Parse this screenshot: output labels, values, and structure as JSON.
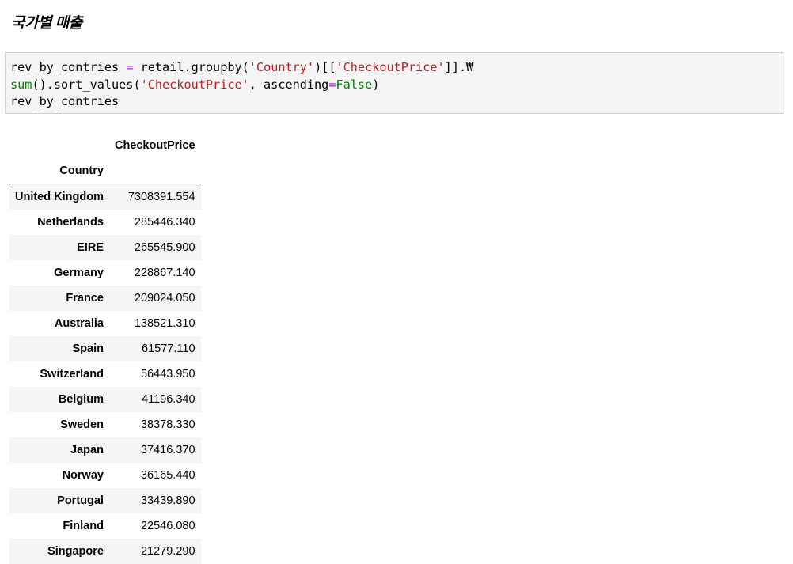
{
  "heading": "국가별 매출",
  "code": {
    "line1": {
      "t1": "rev_by_contries ",
      "t2": "=",
      "t3": " retail.groupby(",
      "t4": "'Country'",
      "t5": ")[[",
      "t6": "'CheckoutPrice'",
      "t7": "]].₩"
    },
    "line2": {
      "t1": "sum",
      "t2": "().sort_values(",
      "t3": "'CheckoutPrice'",
      "t4": ", ascending",
      "t5": "=",
      "t6": "False",
      "t7": ")"
    },
    "line3": "rev_by_contries"
  },
  "table": {
    "column_header": "CheckoutPrice",
    "index_name": "Country",
    "rows": [
      {
        "country": "United Kingdom",
        "value": "7308391.554"
      },
      {
        "country": "Netherlands",
        "value": "285446.340"
      },
      {
        "country": "EIRE",
        "value": "265545.900"
      },
      {
        "country": "Germany",
        "value": "228867.140"
      },
      {
        "country": "France",
        "value": "209024.050"
      },
      {
        "country": "Australia",
        "value": "138521.310"
      },
      {
        "country": "Spain",
        "value": "61577.110"
      },
      {
        "country": "Switzerland",
        "value": "56443.950"
      },
      {
        "country": "Belgium",
        "value": "41196.340"
      },
      {
        "country": "Sweden",
        "value": "38378.330"
      },
      {
        "country": "Japan",
        "value": "37416.370"
      },
      {
        "country": "Norway",
        "value": "36165.440"
      },
      {
        "country": "Portugal",
        "value": "33439.890"
      },
      {
        "country": "Finland",
        "value": "22546.080"
      },
      {
        "country": "Singapore",
        "value": "21279.290"
      }
    ]
  }
}
